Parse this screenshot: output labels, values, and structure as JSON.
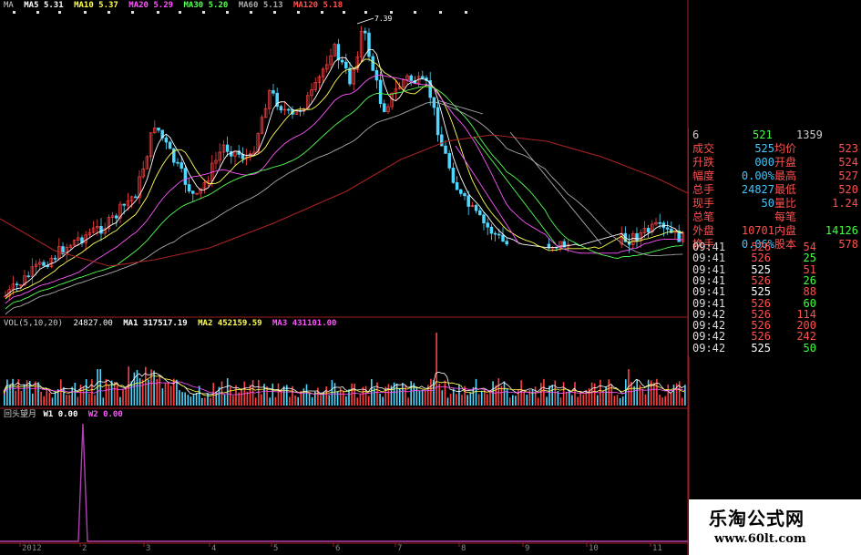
{
  "colors": {
    "up": "#ff4040",
    "down": "#4fd8ff",
    "ma5": "#ffffff",
    "ma10": "#ffff55",
    "ma20": "#ff55ff",
    "ma30": "#55ff55",
    "ma60": "#aaaaaa",
    "ma120": "#aa2222",
    "accent_purple": "#b040b0",
    "label_red": "#ff5050",
    "value_cyan": "#40c8ff",
    "value_green": "#40ff40"
  },
  "price_header": {
    "items": [
      {
        "label": "MA",
        "value": ""
      },
      {
        "label": "MA5",
        "value": "5.31"
      },
      {
        "label": "MA10",
        "value": "5.37"
      },
      {
        "label": "MA20",
        "value": "5.29"
      },
      {
        "label": "MA30",
        "value": "5.20"
      },
      {
        "label": "MA60",
        "value": "5.13"
      },
      {
        "label": "MA120",
        "value": "5.18"
      }
    ]
  },
  "price_high_marker": "7.39",
  "volume_header": {
    "title": "VOL(5,10,20)",
    "vol": "24827.00",
    "ma1_label": "MA1",
    "ma1": "317517.19",
    "ma2_label": "MA2",
    "ma2": "452159.59",
    "ma3_label": "MA3",
    "ma3": "431101.00"
  },
  "indicator_header": {
    "title": "回头望月",
    "w1_label": "W1",
    "w1": "0.00",
    "w2_label": "W2",
    "w2": "0.00"
  },
  "quote_panel": {
    "top": {
      "left": "6",
      "mid": "521",
      "right": "1359"
    },
    "rows": [
      {
        "l1": "成交",
        "v1": "525",
        "l2": "均价",
        "v2": "523"
      },
      {
        "l1": "升跌",
        "v1": "000",
        "l2": "开盘",
        "v2": "524"
      },
      {
        "l1": "幅度",
        "v1": "0.00%",
        "l2": "最高",
        "v2": "527"
      },
      {
        "l1": "总手",
        "v1": "24827",
        "l2": "最低",
        "v2": "520"
      },
      {
        "l1": "现手",
        "v1": "50",
        "l2": "量比",
        "v2": "1.24"
      },
      {
        "l1": "总笔",
        "v1": "",
        "l2": "每笔",
        "v2": ""
      },
      {
        "l1": "外盘",
        "v1": "10701",
        "l2": "内盘",
        "v2": "14126"
      },
      {
        "l1": "换手",
        "v1": "0.06%",
        "l2": "股本",
        "v2": "578"
      }
    ],
    "ticks": [
      {
        "time": "09:41",
        "price": "526",
        "vol": "54"
      },
      {
        "time": "09:41",
        "price": "526",
        "vol": "25"
      },
      {
        "time": "09:41",
        "price": "525",
        "vol": "51"
      },
      {
        "time": "09:41",
        "price": "526",
        "vol": "26"
      },
      {
        "time": "09:41",
        "price": "525",
        "vol": "88"
      },
      {
        "time": "09:41",
        "price": "526",
        "vol": "60"
      },
      {
        "time": "09:42",
        "price": "526",
        "vol": "114"
      },
      {
        "time": "09:42",
        "price": "526",
        "vol": "200"
      },
      {
        "time": "09:42",
        "price": "526",
        "vol": "242"
      },
      {
        "time": "09:42",
        "price": "525",
        "vol": "50"
      }
    ]
  },
  "x_axis": {
    "labels": [
      "2012",
      "2",
      "3",
      "4",
      "5",
      "6",
      "7",
      "8",
      "9",
      "10",
      "11"
    ]
  },
  "watermark": {
    "title": "乐淘公式网",
    "url": "www.60lt.com"
  }
}
